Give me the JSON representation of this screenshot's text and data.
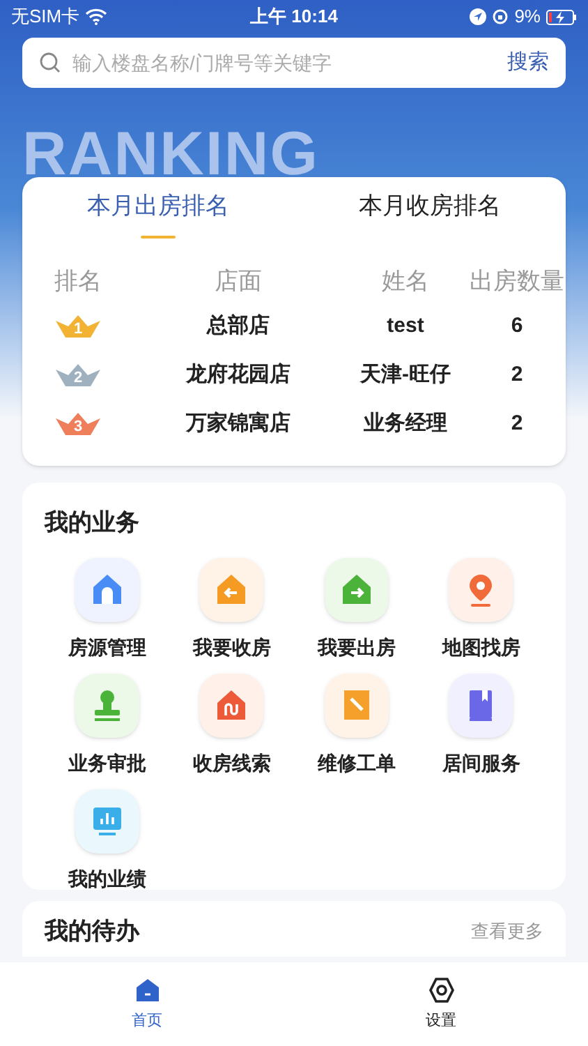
{
  "status_bar": {
    "carrier": "无SIM卡",
    "time": "上午 10:14",
    "battery": "9%"
  },
  "search": {
    "placeholder": "输入楼盘名称/门牌号等关键字",
    "button": "搜索"
  },
  "banner": {
    "title": "RANKING"
  },
  "ranking": {
    "tabs": [
      {
        "label": "本月出房排名",
        "selected": true
      },
      {
        "label": "本月收房排名",
        "selected": false
      }
    ],
    "columns": [
      "排名",
      "店面",
      "姓名",
      "出房数量"
    ],
    "rows": [
      {
        "rank": "1",
        "color": "#f2b233",
        "store": "总部店",
        "name": "test",
        "count": "6"
      },
      {
        "rank": "2",
        "color": "#9fb0bf",
        "store": "龙府花园店",
        "name": "天津-旺仔",
        "count": "2"
      },
      {
        "rank": "3",
        "color": "#ef7f5a",
        "store": "万家锦寓店",
        "name": "业务经理",
        "count": "2"
      }
    ]
  },
  "business": {
    "title": "我的业务",
    "items": [
      {
        "kind": "house",
        "label": "房源管理"
      },
      {
        "kind": "house_in",
        "label": "我要收房"
      },
      {
        "kind": "house_out",
        "label": "我要出房"
      },
      {
        "kind": "map",
        "label": "地图找房"
      },
      {
        "kind": "stamp",
        "label": "业务审批"
      },
      {
        "kind": "route",
        "label": "收房线索"
      },
      {
        "kind": "repair",
        "label": "维修工单"
      },
      {
        "kind": "book",
        "label": "居间服务"
      },
      {
        "kind": "chart",
        "label": "我的业绩"
      }
    ]
  },
  "todo": {
    "title": "我的待办",
    "more": "查看更多"
  },
  "tab_bar": [
    {
      "kind": "home",
      "label": "首页",
      "selected": true
    },
    {
      "kind": "settings",
      "label": "设置",
      "selected": false
    }
  ]
}
